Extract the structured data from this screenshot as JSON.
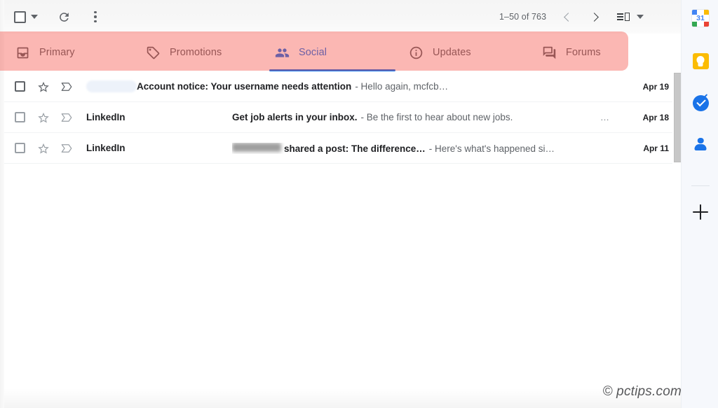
{
  "toolbar": {
    "select_all_label": "Select all",
    "select_all_icon": "checkbox-icon",
    "select_dropdown_icon": "chevron-down-icon",
    "refresh_label": "Refresh",
    "refresh_icon": "refresh-icon",
    "more_label": "More",
    "more_icon": "three-dot-menu-icon",
    "pagination": {
      "range_text": "1–50 of 763",
      "prev_label": "Newer",
      "prev_icon": "chevron-left-icon",
      "next_label": "Older",
      "next_icon": "chevron-right-icon",
      "split_view_label": "Toggle split pane mode",
      "split_view_icon": "split-pane-icon",
      "split_view_caret_icon": "chevron-down-icon"
    }
  },
  "tabs": [
    {
      "label": "Primary",
      "icon": "inbox-icon",
      "active": false
    },
    {
      "label": "Promotions",
      "icon": "tag-icon",
      "active": false
    },
    {
      "label": "Social",
      "icon": "people-icon",
      "active": true
    },
    {
      "label": "Updates",
      "icon": "info-icon",
      "active": false
    },
    {
      "label": "Forums",
      "icon": "forum-icon",
      "active": false
    }
  ],
  "highlight": {
    "color": "#f44336",
    "note": "red highlight overlay across tab row"
  },
  "accent_color": "#1a73e8",
  "list": {
    "rows": [
      {
        "sender": "",
        "sender_redacted": true,
        "subject": "Account notice: Your username needs attention",
        "snippet": "- Hello again, mcfcb…",
        "date": "Apr 19",
        "unread": true,
        "starred": false,
        "has_ellipsis": false,
        "subject_blurred_prefix": false
      },
      {
        "sender": "LinkedIn",
        "sender_redacted": false,
        "subject": "Get job alerts in your inbox.",
        "snippet": "- Be the first to hear about new jobs.",
        "date": "Apr 18",
        "unread": true,
        "starred": false,
        "has_ellipsis": true,
        "ellipsis": "…",
        "subject_blurred_prefix": false
      },
      {
        "sender": "LinkedIn",
        "sender_redacted": false,
        "subject": "shared a post: The difference…",
        "snippet": "- Here's what's happened si…",
        "date": "Apr 11",
        "unread": true,
        "starred": false,
        "has_ellipsis": false,
        "subject_blurred_prefix": true
      }
    ],
    "checkbox_icon": "checkbox-icon",
    "star_icon": "star-icon",
    "important_icon": "important-marker-icon"
  },
  "side_panel": {
    "items": [
      {
        "label": "Calendar",
        "icon": "google-calendar-icon",
        "badge": "31"
      },
      {
        "label": "Keep",
        "icon": "google-keep-icon"
      },
      {
        "label": "Tasks",
        "icon": "google-tasks-icon"
      },
      {
        "label": "Contacts",
        "icon": "google-contacts-icon"
      }
    ],
    "add": {
      "label": "Get add-ons",
      "icon": "plus-icon"
    }
  },
  "watermark": {
    "text": "© pctips.com"
  }
}
